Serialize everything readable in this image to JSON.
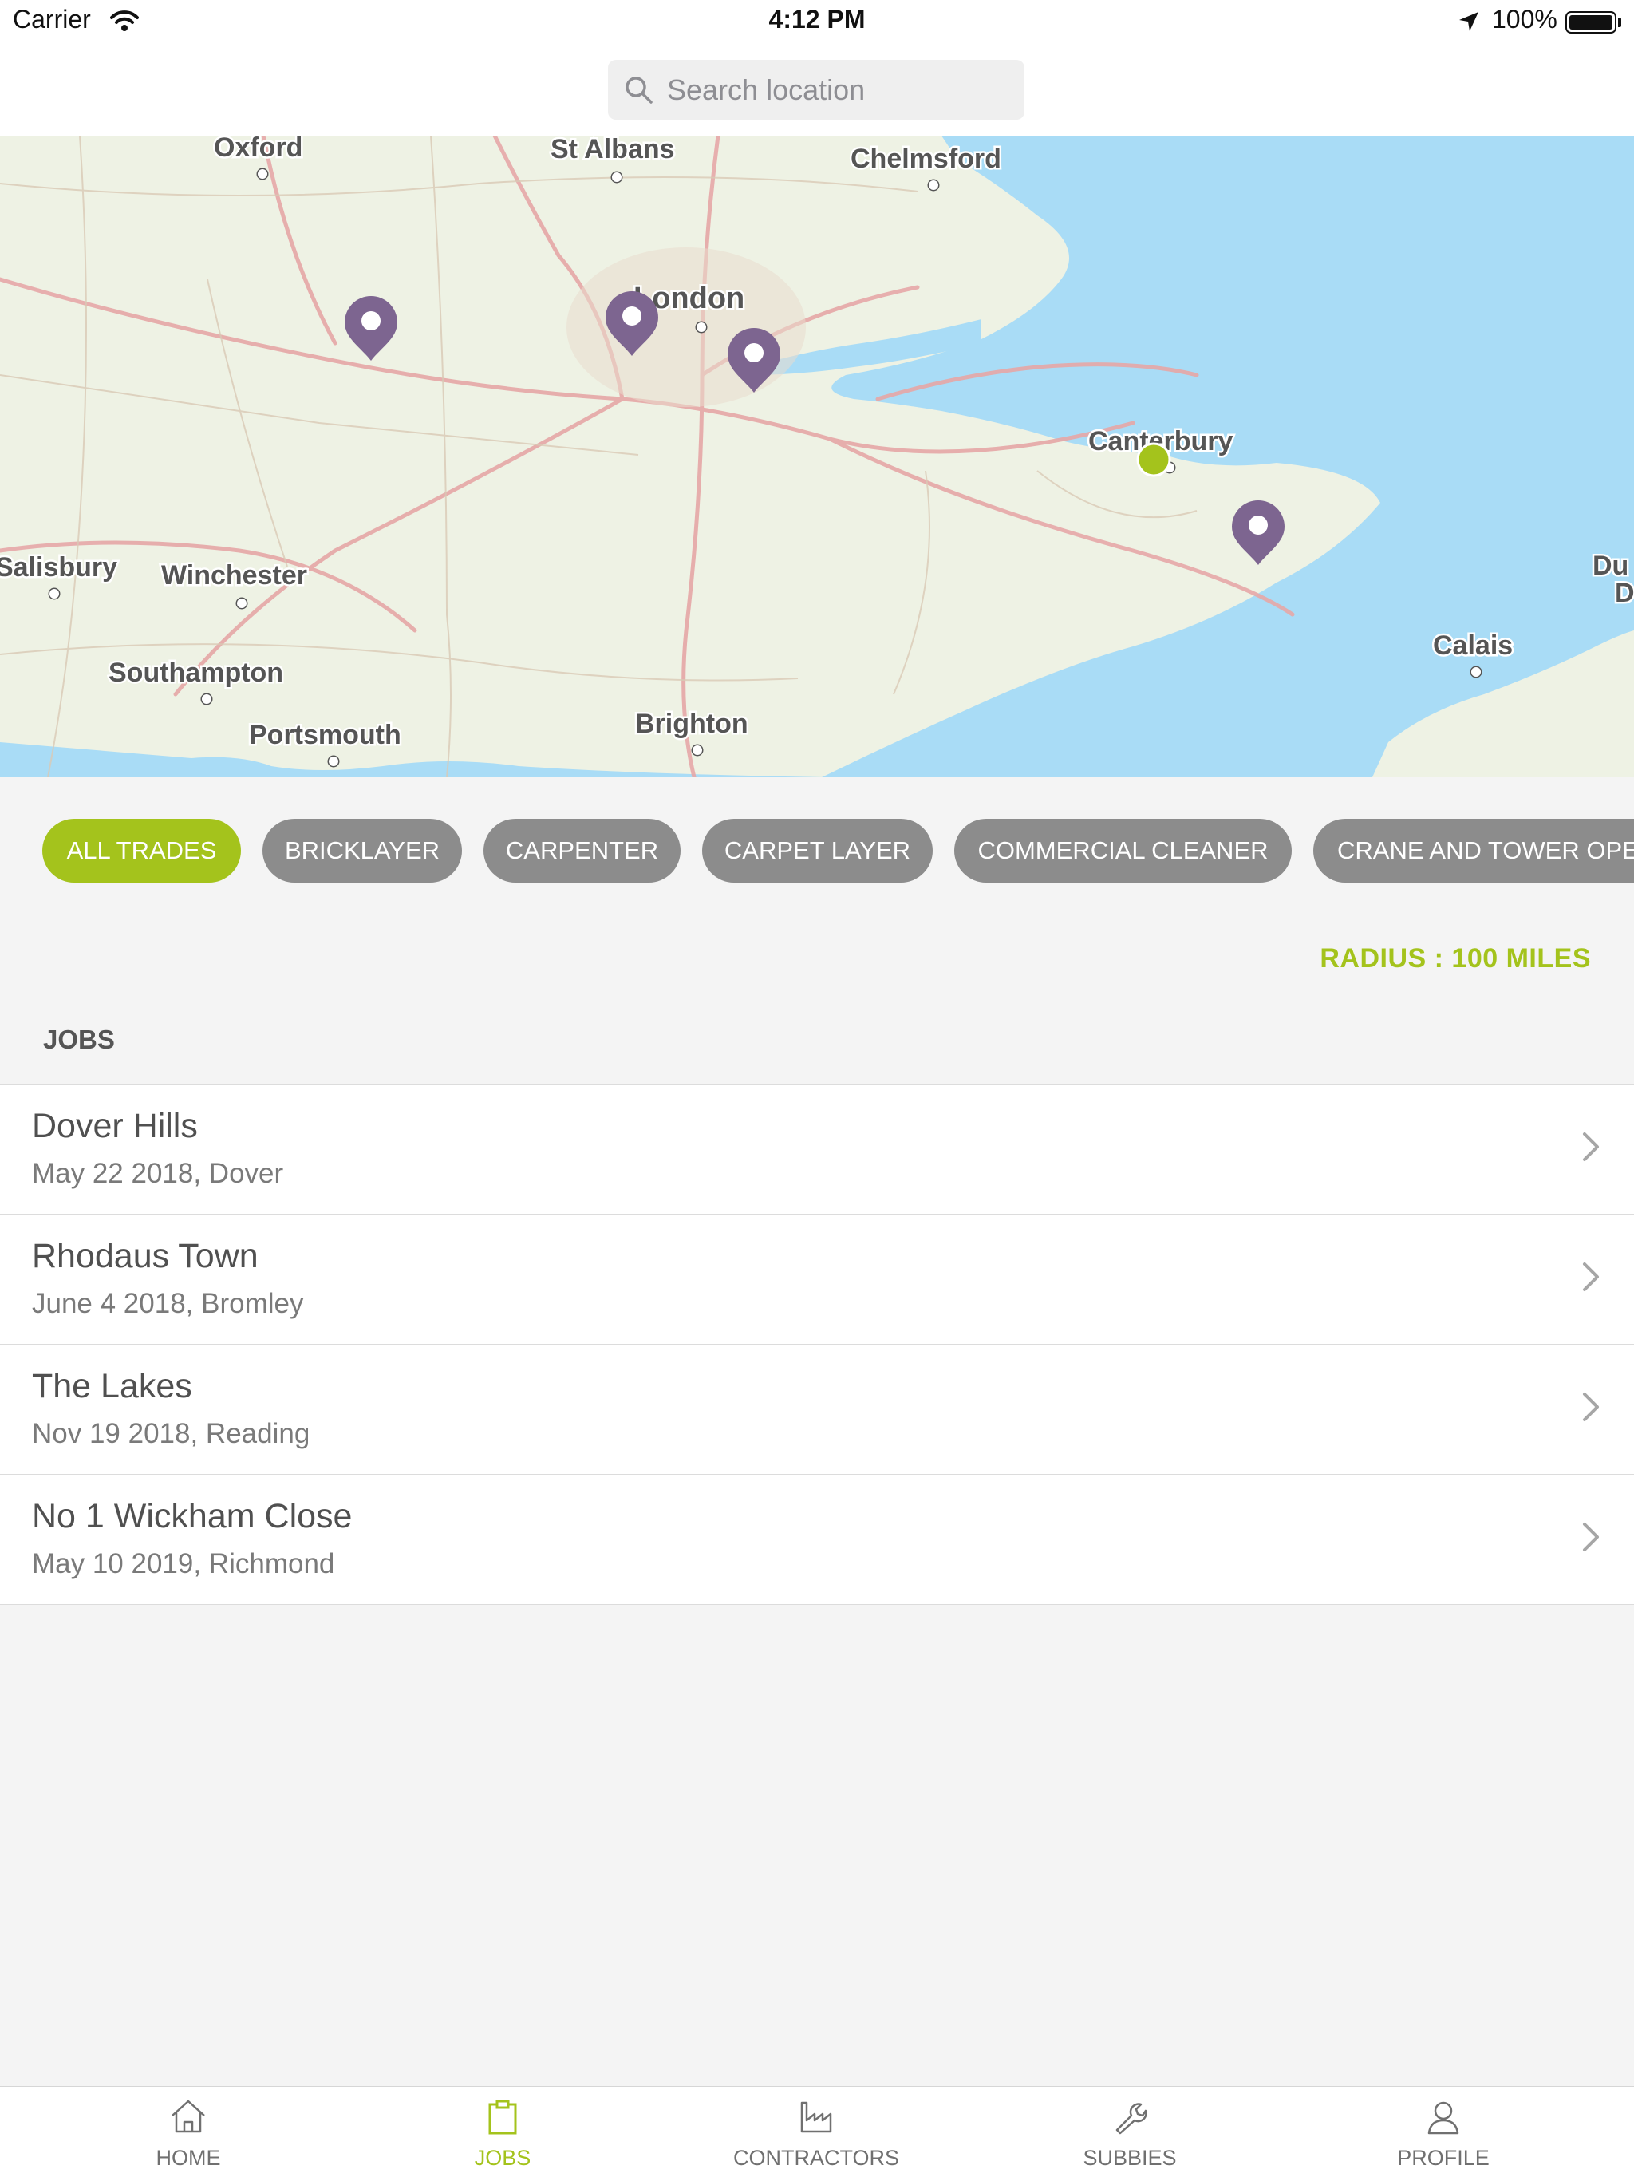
{
  "status_bar": {
    "carrier": "Carrier",
    "time": "4:12 PM",
    "battery": "100%"
  },
  "search": {
    "placeholder": "Search location",
    "value": ""
  },
  "map": {
    "places": [
      "Oxford",
      "St Albans",
      "Chelmsford",
      "London",
      "Canterbury",
      "Salisbury",
      "Winchester",
      "Southampton",
      "Portsmouth",
      "Brighton",
      "Calais",
      "Du",
      "D"
    ],
    "job_pin_color": "#7d6590",
    "current_location_color": "#a4c31c"
  },
  "trades": {
    "items": [
      {
        "label": "ALL TRADES",
        "active": true
      },
      {
        "label": "BRICKLAYER",
        "active": false
      },
      {
        "label": "CARPENTER",
        "active": false
      },
      {
        "label": "CARPET LAYER",
        "active": false
      },
      {
        "label": "COMMERCIAL CLEANER",
        "active": false
      },
      {
        "label": "CRANE AND TOWER OPE",
        "active": false
      }
    ]
  },
  "radius": {
    "label": "RADIUS : 100 MILES"
  },
  "jobs": {
    "title": "JOBS",
    "items": [
      {
        "name": "Dover Hills",
        "details": "May 22 2018, Dover"
      },
      {
        "name": "Rhodaus Town",
        "details": "June 4 2018, Bromley"
      },
      {
        "name": "The Lakes",
        "details": "Nov 19 2018, Reading"
      },
      {
        "name": "No 1 Wickham Close",
        "details": "May 10 2019, Richmond"
      }
    ]
  },
  "tabs": {
    "items": [
      {
        "label": "HOME",
        "icon": "home-icon",
        "active": false
      },
      {
        "label": "JOBS",
        "icon": "clipboard-icon",
        "active": true
      },
      {
        "label": "CONTRACTORS",
        "icon": "factory-icon",
        "active": false
      },
      {
        "label": "SUBBIES",
        "icon": "wrench-icon",
        "active": false
      },
      {
        "label": "PROFILE",
        "icon": "user-icon",
        "active": false
      }
    ]
  },
  "colors": {
    "accent": "#a4c31c",
    "chip_inactive": "#8c8c8c",
    "background": "#f4f4f4"
  }
}
